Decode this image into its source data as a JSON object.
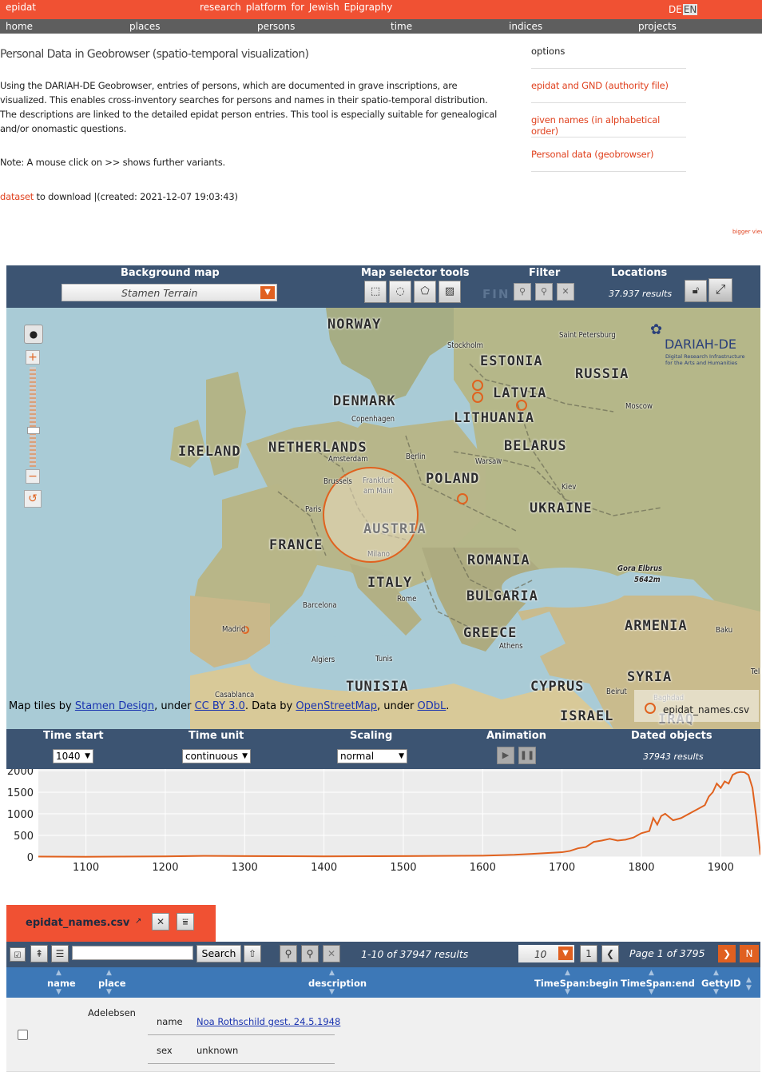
{
  "topbar": {
    "brand": "epidat",
    "tagline": "research platform for Jewish Epigraphy",
    "lang_de": "DE",
    "lang_en": "EN"
  },
  "nav": {
    "home": "home",
    "places": "places",
    "persons": "persons",
    "time": "time",
    "indices": "indices",
    "projects": "projects"
  },
  "page": {
    "title": "Personal Data in Geobrowser (spatio-temporal visualization)",
    "intro": "Using the DARIAH-DE Geobrowser, entries of persons, which are documented in grave inscriptions, are visualized. This enables cross-inventory searches for persons and names in their spatio-temporal distribution. The descriptions are linked to the detailed epidat person entries. This tool is especially suitable for genealogical and/or onomastic questions.",
    "note": "Note: A mouse click on >> shows further variants.",
    "dataset_link": "dataset",
    "dataset_rest": " to download |(created: 2021-12-07 19:03:43)",
    "bigger_view": "bigger view"
  },
  "options": {
    "title": "options",
    "items": [
      "epidat and GND (authority file)",
      "given names (in alphabetical order)",
      "Personal data (geobrowser)"
    ]
  },
  "geobrowser": {
    "background_map_label": "Background map",
    "background_map_value": "Stamen Terrain",
    "selector_tools_label": "Map selector tools",
    "filter_label": "Filter",
    "filter_text": "FIN",
    "locations_label": "Locations",
    "locations_results": "37.937 results",
    "attribution": {
      "prefix": "Map tiles by ",
      "stamen": "Stamen Design",
      "under1": ", under ",
      "ccby": "CC BY 3.0",
      "data_by": ". Data by ",
      "osm": "OpenStreetMap",
      "under2": ", under ",
      "odbl": "ODbL",
      "end": "."
    },
    "legend_name": "epidat_names.csv",
    "logo_title": "DARIAH-DE",
    "logo_sub1": "Digital Research Infrastructure",
    "logo_sub2": "for the Arts and Humanities"
  },
  "map_labels": {
    "countries": [
      "NORWAY",
      "ESTONIA",
      "RUSSIA",
      "LATVIA",
      "DENMARK",
      "LITHUANIA",
      "IRELAND",
      "NETHERLANDS",
      "BELARUS",
      "POLAND",
      "UKRAINE",
      "AUSTRIA",
      "FRANCE",
      "ROMANIA",
      "ITALY",
      "BULGARIA",
      "GREECE",
      "ARMENIA",
      "SYRIA",
      "CYPRUS",
      "TUNISIA",
      "ISRAEL",
      "IRAQ"
    ],
    "cities": [
      "Stockholm",
      "Saint Petersburg",
      "Copenhagen",
      "Moscow",
      "Amsterdam",
      "Berlin",
      "Warsaw",
      "Brussels",
      "Frankfurt",
      "am Main",
      "Kiev",
      "Paris",
      "Milano",
      "Gora Elbrus",
      "5642m",
      "Barcelona",
      "Rome",
      "Madrid",
      "Baku",
      "Athens",
      "Algiers",
      "Tunis",
      "Casablanca",
      "Beirut",
      "Baghdad",
      "Tel"
    ]
  },
  "time": {
    "start_label": "Time start",
    "start_value": "1040",
    "unit_label": "Time unit",
    "unit_value": "continuous",
    "scaling_label": "Scaling",
    "scaling_value": "normal",
    "animation_label": "Animation",
    "dated_label": "Dated objects",
    "dated_results": "37943 results"
  },
  "chart_data": {
    "type": "line",
    "x_ticks": [
      "1100",
      "1200",
      "1300",
      "1400",
      "1500",
      "1600",
      "1700",
      "1800",
      "1900"
    ],
    "y_ticks": [
      "0",
      "500",
      "1000",
      "1500",
      "2000"
    ],
    "ylim": [
      0,
      2000
    ],
    "xlim": [
      1040,
      1950
    ],
    "color": "#e0621f",
    "x": [
      1040,
      1100,
      1200,
      1250,
      1300,
      1400,
      1500,
      1550,
      1600,
      1640,
      1660,
      1680,
      1700,
      1710,
      1720,
      1730,
      1740,
      1750,
      1760,
      1770,
      1780,
      1790,
      1800,
      1810,
      1815,
      1820,
      1825,
      1830,
      1840,
      1850,
      1860,
      1870,
      1880,
      1885,
      1890,
      1895,
      1900,
      1905,
      1910,
      1915,
      1920,
      1925,
      1930,
      1935,
      1940,
      1945,
      1950
    ],
    "y": [
      10,
      5,
      15,
      25,
      20,
      15,
      20,
      25,
      30,
      50,
      70,
      90,
      110,
      140,
      200,
      230,
      350,
      380,
      420,
      380,
      400,
      450,
      550,
      600,
      900,
      750,
      950,
      1000,
      850,
      900,
      1000,
      1100,
      1200,
      1400,
      1500,
      1700,
      1600,
      1750,
      1700,
      1900,
      1950,
      1970,
      1960,
      1900,
      1600,
      900,
      50
    ]
  },
  "table": {
    "tab_name": "epidat_names.csv",
    "search_placeholder": "",
    "search_label": "Search",
    "results_info": "1-10 of 37947 results",
    "page_size": "10",
    "page_first": "1",
    "page_info": "Page 1 of 3795",
    "page_last": "N",
    "columns": [
      "name",
      "place",
      "description",
      "TimeSpan:begin",
      "TimeSpan:end",
      "GettyID"
    ],
    "rows": [
      {
        "place": "Adelebsen",
        "desc_name_key": "name",
        "desc_name_value": "Noa Rothschild gest. 24.5.1948",
        "desc_sex_key": "sex",
        "desc_sex_value": "unknown"
      }
    ]
  }
}
